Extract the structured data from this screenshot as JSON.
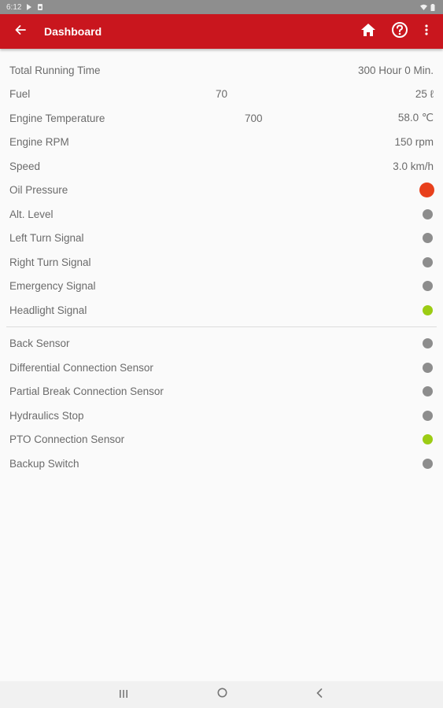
{
  "status_bar": {
    "time": "6:12"
  },
  "app_bar": {
    "title": "Dashboard"
  },
  "readings": [
    {
      "label": "Total Running Time",
      "mid": "",
      "value": "300 Hour 0 Min."
    },
    {
      "label": "Fuel",
      "mid": "70",
      "value": "25 ℓ"
    },
    {
      "label": "Engine Temperature",
      "mid": "700",
      "value": "58.0 ℃"
    },
    {
      "label": "Engine RPM",
      "mid": "",
      "value": "150 rpm"
    },
    {
      "label": "Speed",
      "mid": "",
      "value": "3.0 km/h"
    }
  ],
  "signals": [
    {
      "label": "Oil Pressure",
      "state": "alert",
      "color": "#e8401c"
    },
    {
      "label": "Alt. Level",
      "state": "off",
      "color": "#8d8d8d"
    },
    {
      "label": "Left Turn Signal",
      "state": "off",
      "color": "#8d8d8d"
    },
    {
      "label": "Right Turn Signal",
      "state": "off",
      "color": "#8d8d8d"
    },
    {
      "label": "Emergency Signal",
      "state": "off",
      "color": "#8d8d8d"
    },
    {
      "label": "Headlight Signal",
      "state": "on",
      "color": "#9ccc14"
    }
  ],
  "sensors": [
    {
      "label": "Back Sensor",
      "state": "off",
      "color": "#8d8d8d"
    },
    {
      "label": "Differential Connection Sensor",
      "state": "off",
      "color": "#8d8d8d"
    },
    {
      "label": "Partial Break Connection Sensor",
      "state": "off",
      "color": "#8d8d8d"
    },
    {
      "label": "Hydraulics Stop",
      "state": "off",
      "color": "#8d8d8d"
    },
    {
      "label": "PTO Connection Sensor",
      "state": "on",
      "color": "#9ccc14"
    },
    {
      "label": "Backup Switch",
      "state": "off",
      "color": "#8d8d8d"
    }
  ],
  "icons": {
    "back": "arrow-back-icon",
    "home": "home-icon",
    "help": "help-icon",
    "more": "more-vert-icon",
    "nav_recents": "recents-icon",
    "nav_home": "nav-home-icon",
    "nav_back": "nav-back-icon"
  },
  "colors": {
    "app_bar": "#c9161e",
    "alert": "#e8401c",
    "on": "#9ccc14",
    "off": "#8d8d8d"
  }
}
